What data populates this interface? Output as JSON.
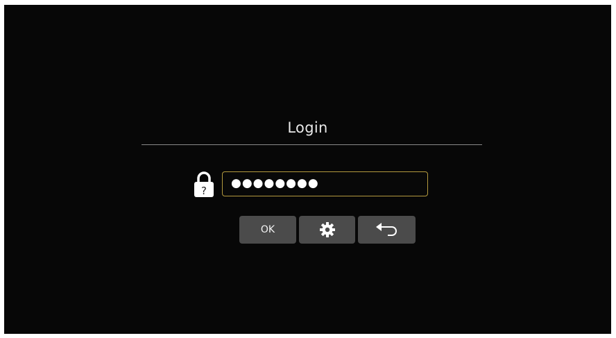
{
  "login": {
    "title": "Login",
    "password_value": "●●●●●●●●",
    "lock_hint_glyph": "?"
  },
  "buttons": {
    "ok_label": "OK",
    "settings_icon": "gear-icon",
    "back_icon": "back-arrow-icon"
  },
  "colors": {
    "background": "#070707",
    "field_border": "#b49a3e",
    "button_bg": "#4b4b4b"
  }
}
